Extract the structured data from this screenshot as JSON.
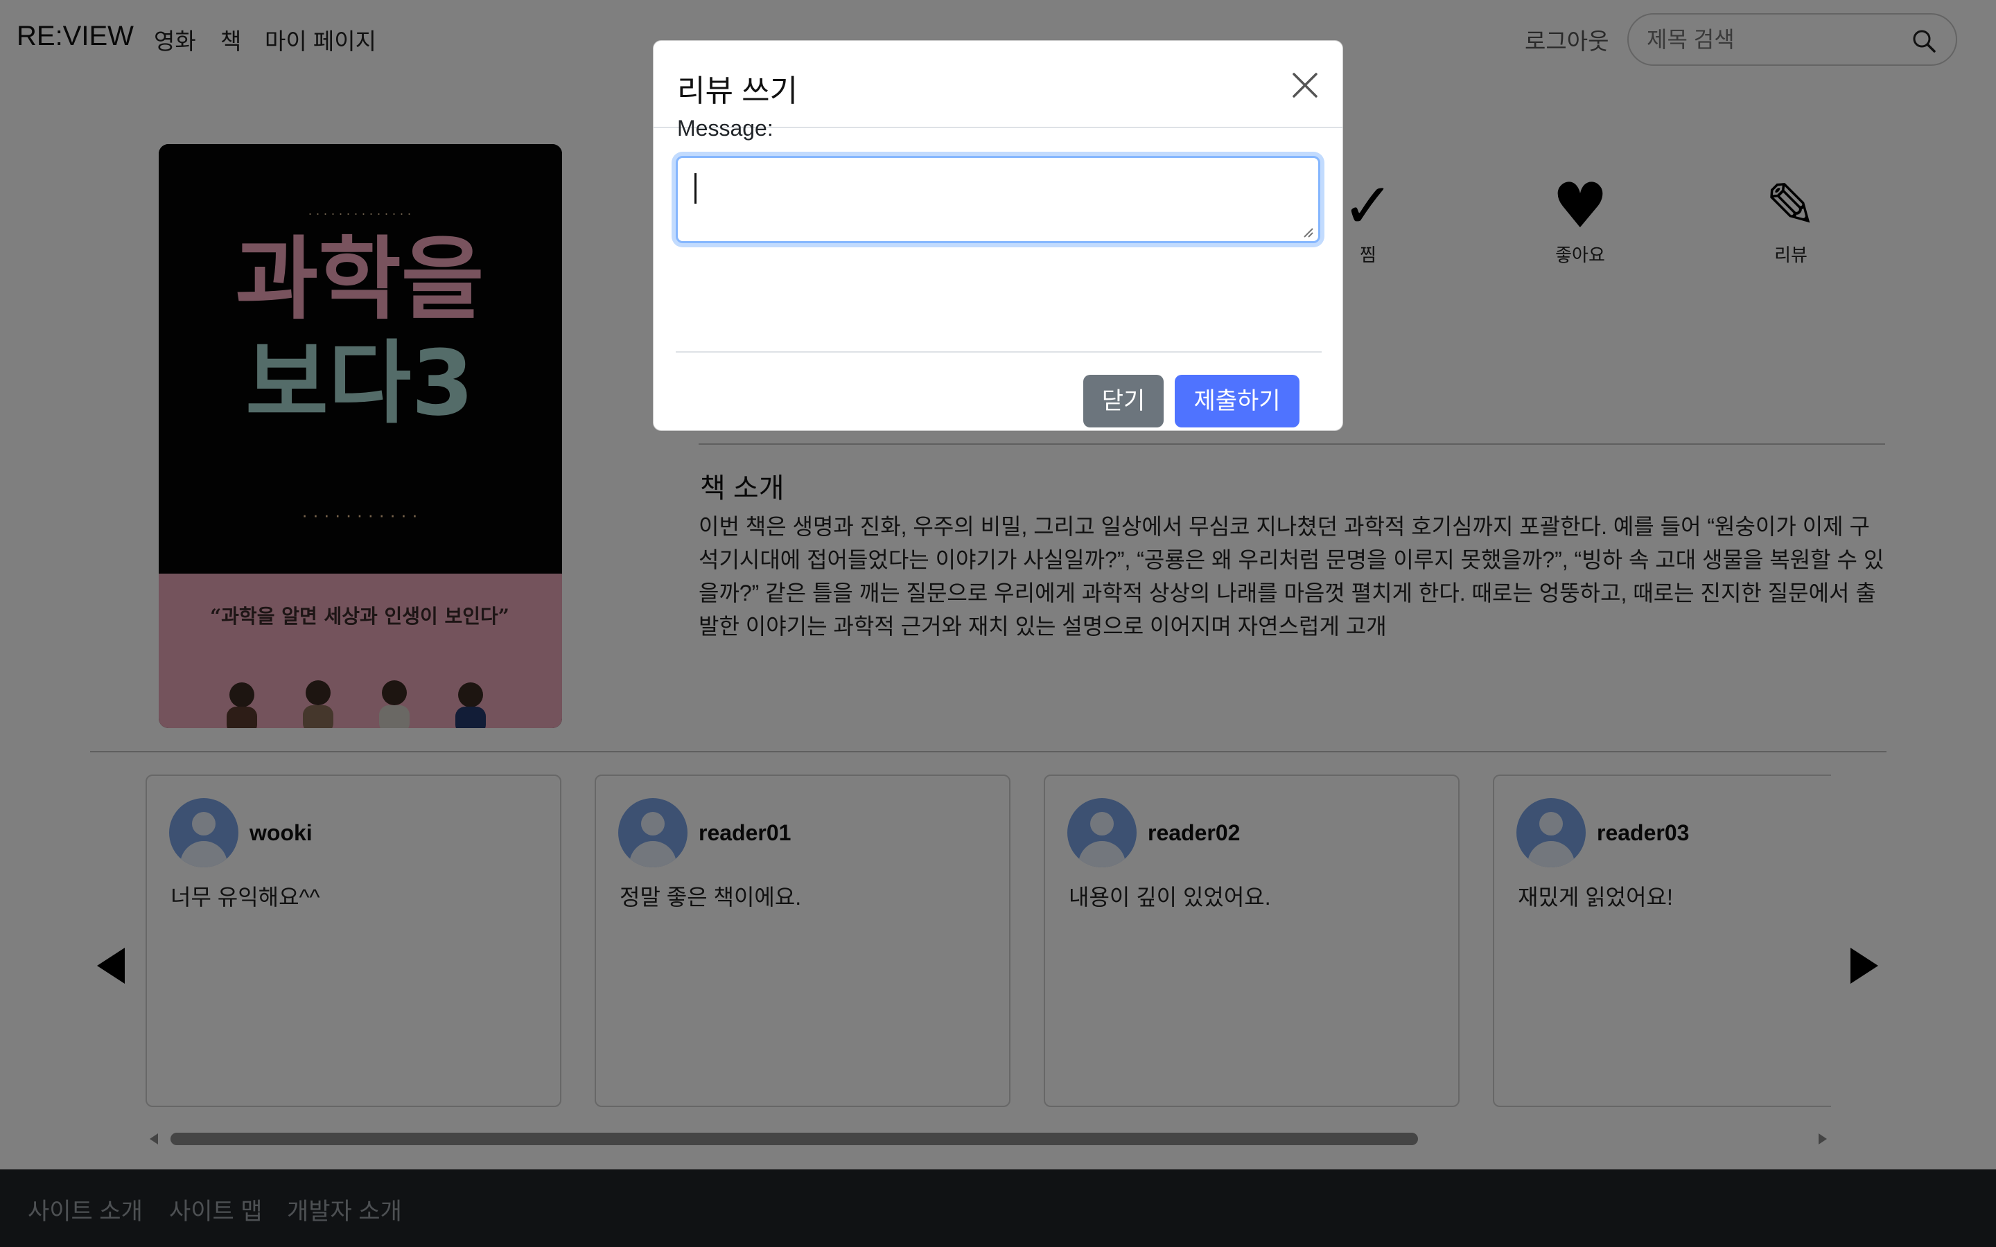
{
  "nav": {
    "brand": "RE:VIEW",
    "links": [
      "영화",
      "책",
      "마이 페이지"
    ],
    "logout": "로그아웃",
    "search_placeholder": "제목 검색"
  },
  "actions": [
    {
      "icon": "check-icon",
      "glyph": "✓",
      "label": "찜"
    },
    {
      "icon": "heart-icon",
      "glyph": "♥",
      "label": "좋아요"
    },
    {
      "icon": "pencil-icon",
      "glyph": "✎",
      "label": "리뷰"
    }
  ],
  "intro": {
    "title": "책 소개",
    "text": "이번 책은 생명과 진화, 우주의 비밀, 그리고 일상에서 무심코 지나쳤던 과학적 호기심까지 포괄한다. 예를 들어 “원숭이가 이제 구석기시대에 접어들었다는 이야기가 사실일까?”, “공룡은 왜 우리처럼 문명을 이루지 못했을까?”, “빙하 속 고대 생물을 복원할 수 있을까?” 같은 틀을 깨는 질문으로 우리에게 과학적 상상의 나래를 마음껏 펼치게 한다. 때로는 엉뚱하고, 때로는 진지한 질문에서 출발한 이야기는 과학적 근거와 재치 있는 설명으로 이어지며 자연스럽게 고개"
  },
  "cover": {
    "title_line1": "과학을",
    "title_line2": "보다3",
    "caption": "“과학을 알면 세상과 인생이 보인다”"
  },
  "reviews": [
    {
      "user": "wooki",
      "text": "너무 유익해요^^"
    },
    {
      "user": "reader01",
      "text": "정말 좋은 책이에요."
    },
    {
      "user": "reader02",
      "text": "내용이 깊이 있었어요."
    },
    {
      "user": "reader03",
      "text": "재밌게 읽었어요!"
    }
  ],
  "footer": {
    "links": [
      "사이트 소개",
      "사이트 맵",
      "개발자 소개"
    ]
  },
  "modal": {
    "title": "리뷰 쓰기",
    "message_label": "Message:",
    "message_value": "",
    "close_label": "닫기",
    "submit_label": "제출하기"
  },
  "colors": {
    "primary": "#0d6efd",
    "secondary": "#6c757d",
    "footer_bg": "#212529",
    "focus_ring": "#86b7fe"
  }
}
